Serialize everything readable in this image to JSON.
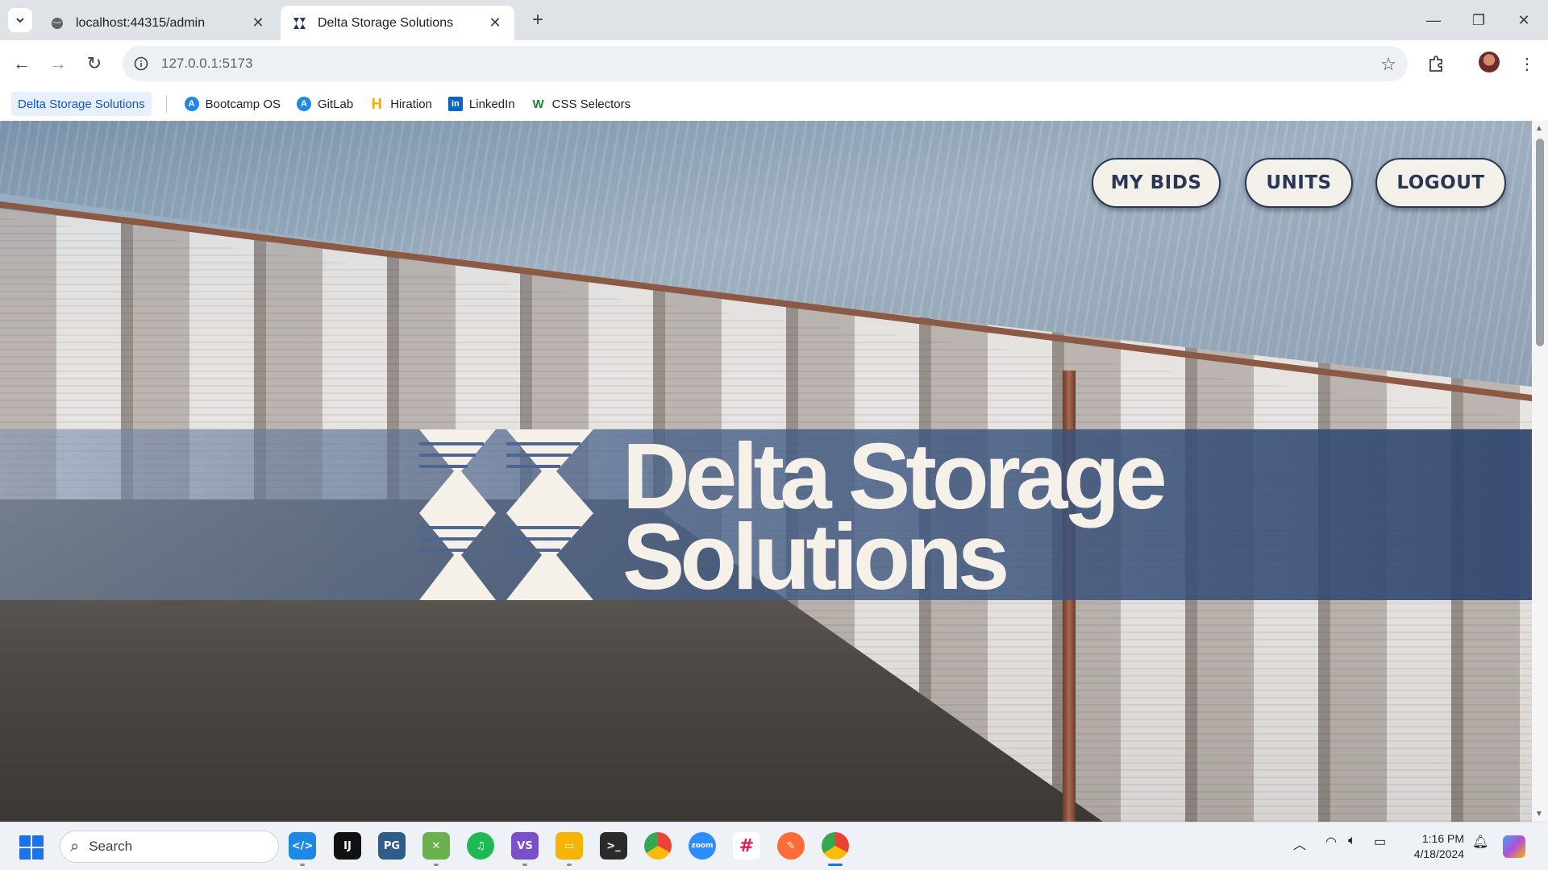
{
  "browser": {
    "tabs": [
      {
        "title": "localhost:44315/admin",
        "active": false
      },
      {
        "title": "Delta Storage Solutions",
        "active": true
      }
    ],
    "new_tab_symbol": "+",
    "close_symbol": "✕",
    "address": "127.0.0.1:5173",
    "bookmarks": [
      {
        "label": "Delta Storage Solutions",
        "icon": "none"
      },
      {
        "label": "Bootcamp OS",
        "icon": "a-circle-icon"
      },
      {
        "label": "GitLab",
        "icon": "a-circle-icon"
      },
      {
        "label": "Hiration",
        "icon": "h-icon"
      },
      {
        "label": "LinkedIn",
        "icon": "linkedin-icon"
      },
      {
        "label": "CSS Selectors",
        "icon": "w-icon"
      }
    ]
  },
  "page": {
    "nav": {
      "my_bids": "MY BIDS",
      "units": "UNITS",
      "logout": "LOGOUT"
    },
    "brand": {
      "line1": "Delta Storage",
      "line2": "Solutions"
    },
    "colors": {
      "brand_navy": "#2a3655",
      "button_bg": "#f4f0ea",
      "brand_text": "#f5f0e8"
    }
  },
  "taskbar": {
    "search_placeholder": "Search",
    "apps": [
      "vscode",
      "intellij",
      "postgres",
      "drawio",
      "spotify",
      "visual-studio",
      "file-explorer",
      "terminal",
      "chrome",
      "zoom",
      "slack",
      "postman",
      "chrome-active"
    ],
    "time": "1:16 PM",
    "date": "4/18/2024"
  }
}
